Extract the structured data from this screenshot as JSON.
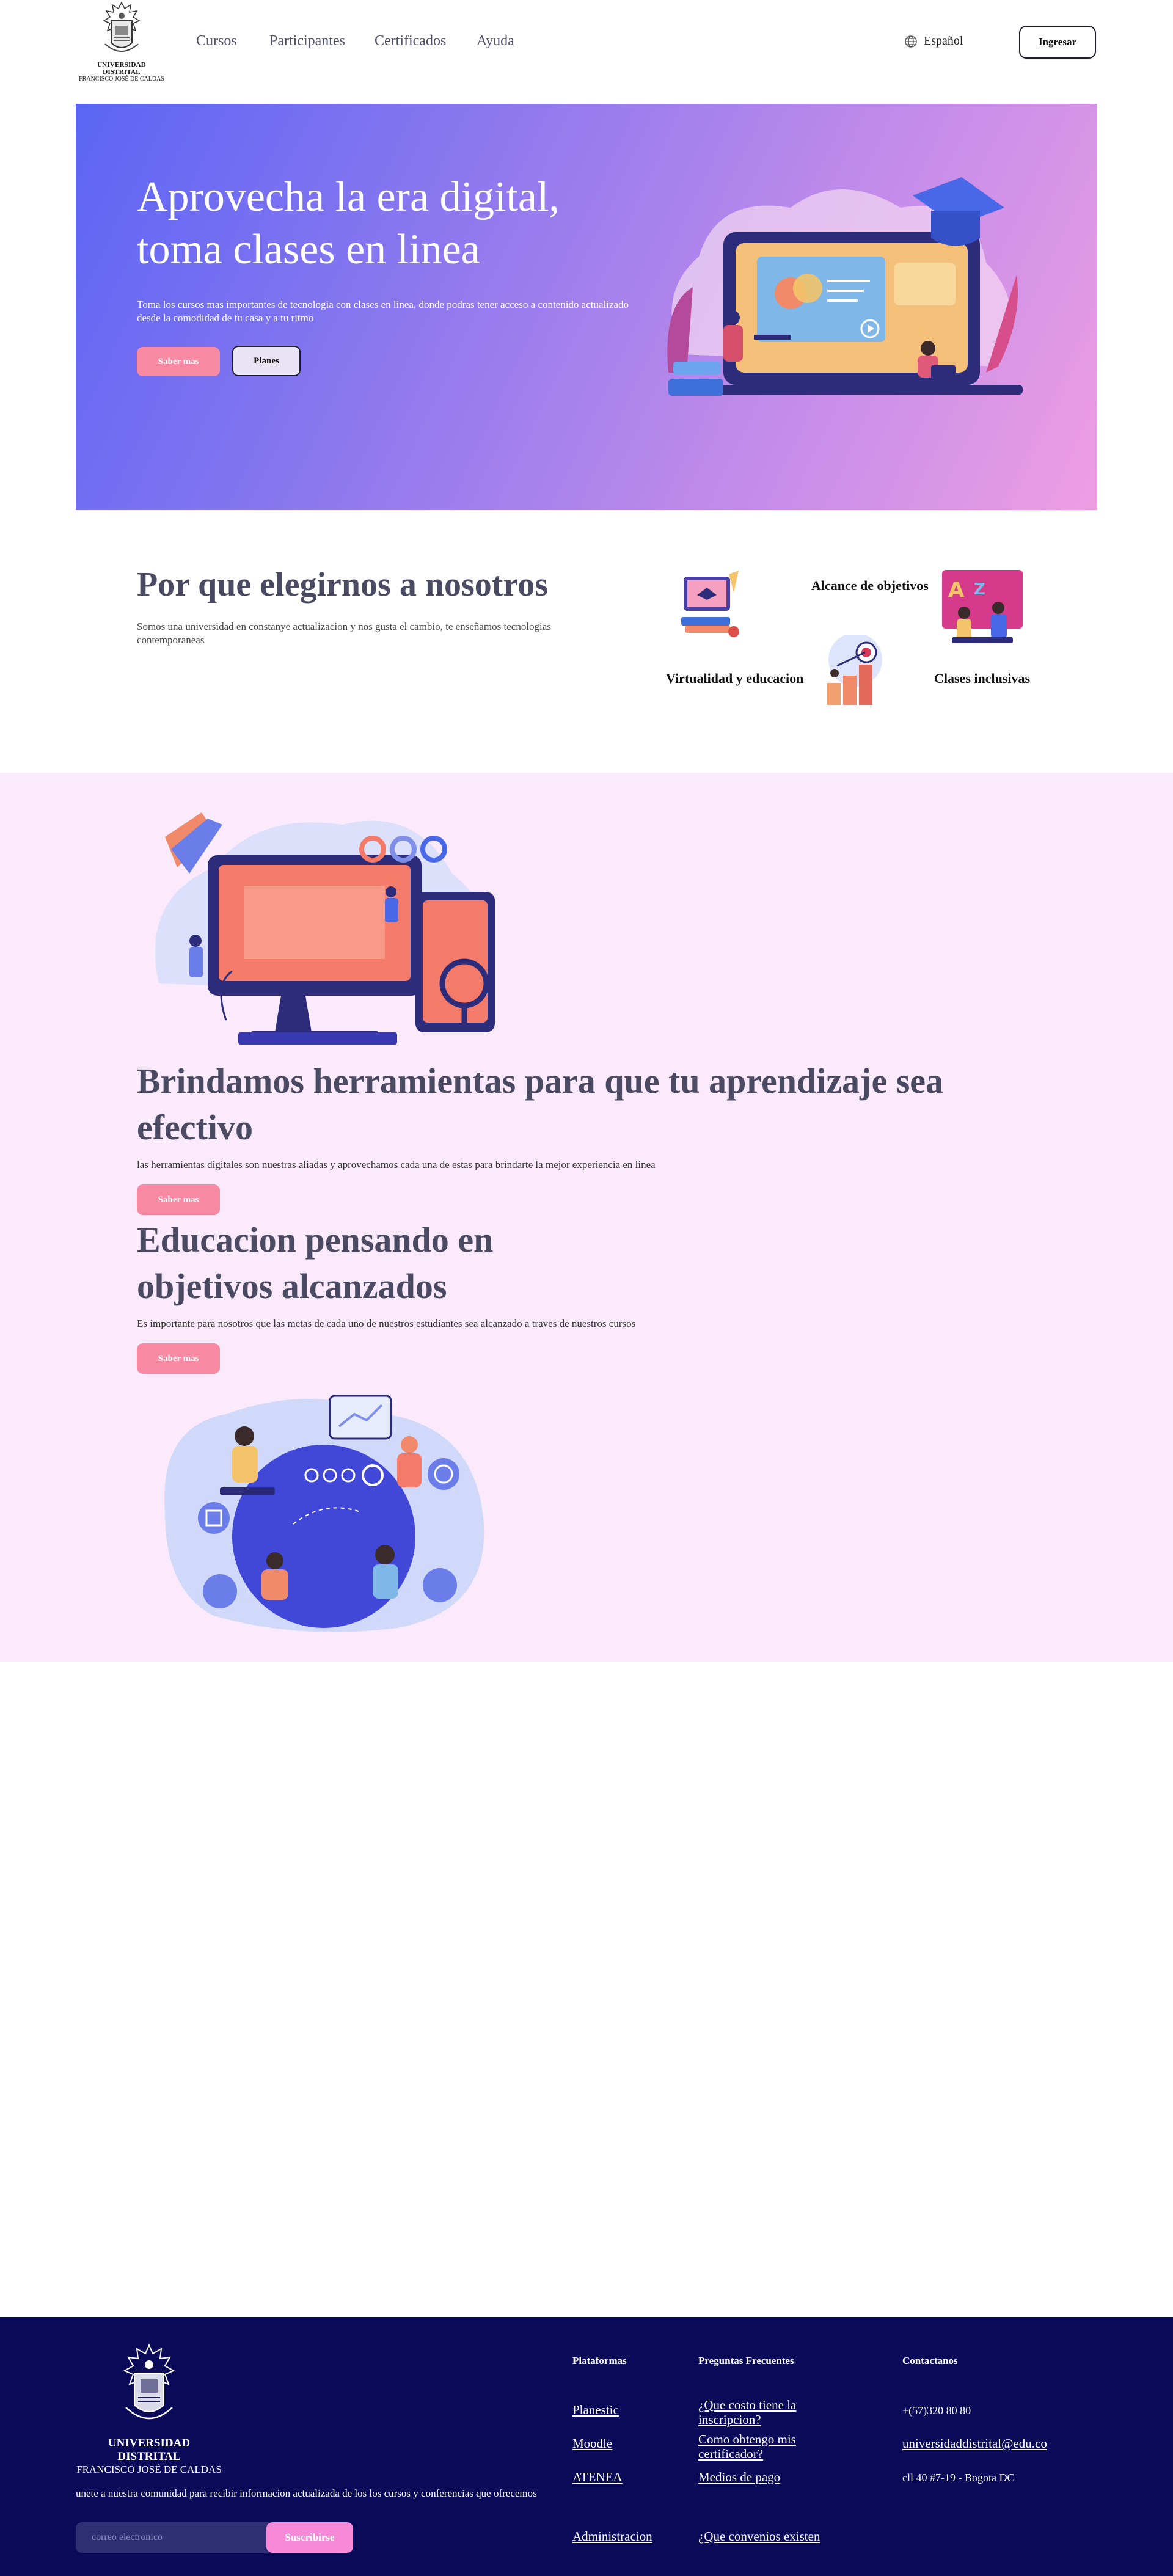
{
  "header": {
    "logo_line1": "UNIVERSIDAD DISTRITAL",
    "logo_line2": "FRANCISCO JOSÉ DE CALDAS",
    "nav": [
      "Cursos",
      "Participantes",
      "Certificados",
      "Ayuda"
    ],
    "language": "Español",
    "login_label": "Ingresar"
  },
  "hero": {
    "title": "Aprovecha la era digital, toma clases en linea",
    "text": "Toma los cursos mas importantes de tecnologia con clases en linea, donde podras tener acceso a contenido actualizado desde la comodidad de tu casa y a tu ritmo",
    "primary_button": "Saber mas",
    "secondary_button": "Planes"
  },
  "why": {
    "title": "Por que elegirnos a nosotros",
    "text": "Somos una universidad en constanye actualizacion y nos gusta el cambio, te enseñamos tecnologias contemporaneas",
    "features": [
      "Alcance de objetivos",
      "Virtualidad y educacion",
      "Clases inclusivas"
    ],
    "features_line2": [
      "objetivos",
      "educacion",
      "inclusivas"
    ]
  },
  "tools": {
    "title": "Brindamos herramientas para que tu aprendizaje sea efectivo",
    "text": "las herramientas digitales son nuestras aliadas y aprovechamos cada una de estas para brindarte la mejor experiencia en linea",
    "button": "Saber mas"
  },
  "goals": {
    "title": "Educacion pensando en objetivos alcanzados",
    "text": "Es importante para nosotros que las metas de cada uno de nuestros estudiantes sea alcanzado a traves de nuestros cursos",
    "button": "Saber mas"
  },
  "footer": {
    "logo_line1": "UNIVERSIDAD DISTRITAL",
    "logo_line2": "FRANCISCO JOSÉ DE CALDAS",
    "newsletter_text": "unete a nuestra comunidad para recibir informacion actualizada de los los cursos y conferencias que ofrecemos",
    "email_placeholder": "correo electronico",
    "subscribe_label": "Suscribirse",
    "col_platforms": {
      "heading": "Plataformas",
      "links": [
        "Planestic",
        "Moodle",
        "ATENEA",
        "Administracion"
      ]
    },
    "col_faq": {
      "heading": "Preguntas Frecuentes",
      "links": [
        "¿Que costo tiene la inscripcion?",
        "Como obtengo mis certificador?",
        "Medios de pago",
        "¿Que convenios existen"
      ]
    },
    "col_contact": {
      "heading": "Contactanos",
      "phone": "+(57)320 80 80",
      "email": "universidaddistrital@edu.co",
      "address": "cll 40 #7-19 - Bogota DC"
    }
  },
  "colors": {
    "hero_gradient_start": "#5b65f5",
    "hero_gradient_end": "#ee9ee3",
    "pink_button": "#f78aa2",
    "section_bg": "#fbeafb",
    "footer_bg": "#0a0a58",
    "subscribe_bg": "#f68ad9",
    "heading_color": "#4a4a63"
  }
}
